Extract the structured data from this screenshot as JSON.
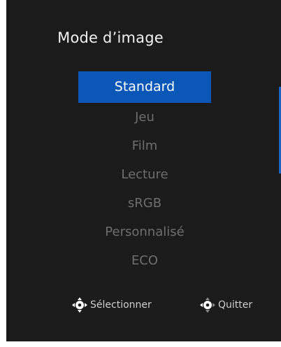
{
  "osd": {
    "title": "Mode d’image",
    "items": [
      {
        "label": "Standard",
        "selected": true
      },
      {
        "label": "Jeu",
        "selected": false
      },
      {
        "label": "Film",
        "selected": false
      },
      {
        "label": "Lecture",
        "selected": false
      },
      {
        "label": "sRGB",
        "selected": false
      },
      {
        "label": "Personnalisé",
        "selected": false
      },
      {
        "label": "ECO",
        "selected": false
      }
    ],
    "footer": {
      "select_label": "Sélectionner",
      "select_icon": "joystick-select-icon",
      "quit_label": "Quitter",
      "quit_icon": "joystick-left-icon"
    }
  },
  "colors": {
    "background": "#1b1b1b",
    "accent": "#0a57b8",
    "text": "#f2f2f2",
    "inactive_text": "#6e6e6e"
  }
}
